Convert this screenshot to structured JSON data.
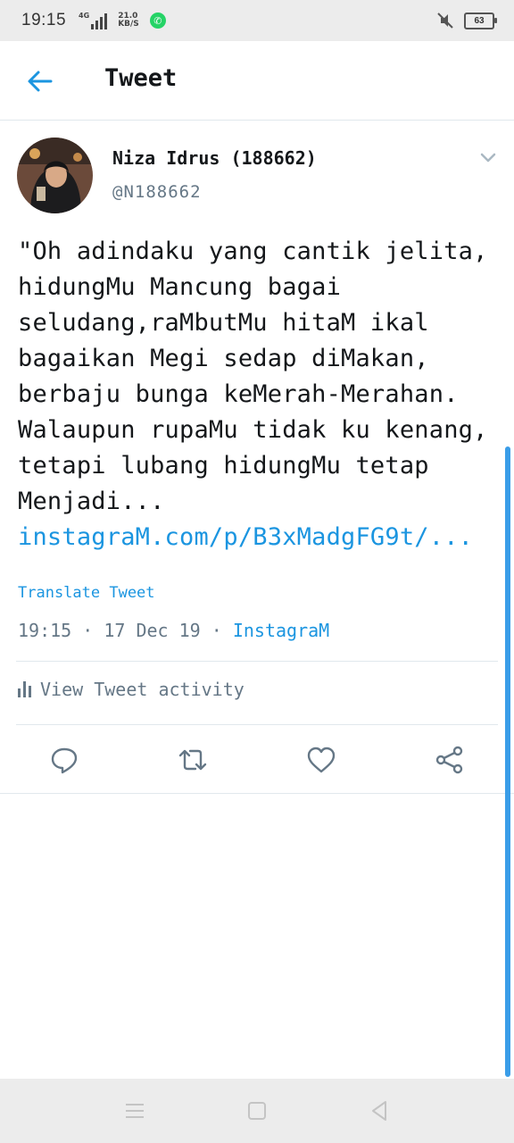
{
  "status_bar": {
    "time": "19:15",
    "network_label": "4G",
    "speed_value": "21.0",
    "speed_unit": "KB/S",
    "battery": "63",
    "icons": [
      "whatsapp-icon",
      "mute-icon",
      "battery-icon"
    ]
  },
  "header": {
    "title": "Tweet",
    "back_icon": "arrow-left-icon"
  },
  "tweet": {
    "author_name": "Niza Idrus (188662)",
    "handle": "@N188662",
    "text": "\"Oh adindaku yang cantik jelita, hidungMu Mancung bagai seludang,raMbutMu hitaM ikal bagaikan Megi sedap diMakan, berbaju bunga keMerah-Merahan. Walaupun rupaMu tidak ku kenang, tetapi lubang hidungMu tetap Menjadi...",
    "link": "instagraM.com/p/B3xMadgFG9t/...",
    "translate_label": "Translate Tweet",
    "time": "19:15",
    "date": "17 Dec 19",
    "source": "InstagraM",
    "separator": " · "
  },
  "activity": {
    "label": "View Tweet activity"
  },
  "actions": [
    {
      "name": "reply",
      "icon": "reply-icon"
    },
    {
      "name": "retweet",
      "icon": "retweet-icon"
    },
    {
      "name": "like",
      "icon": "heart-icon"
    },
    {
      "name": "share",
      "icon": "share-icon"
    }
  ],
  "colors": {
    "accent": "#1b95e0",
    "text": "#14171a",
    "secondary": "#657786",
    "divider": "#e1e8ed",
    "system_bar": "#ececec"
  },
  "nav_bar": [
    "menu-icon",
    "home-icon",
    "back-icon"
  ]
}
